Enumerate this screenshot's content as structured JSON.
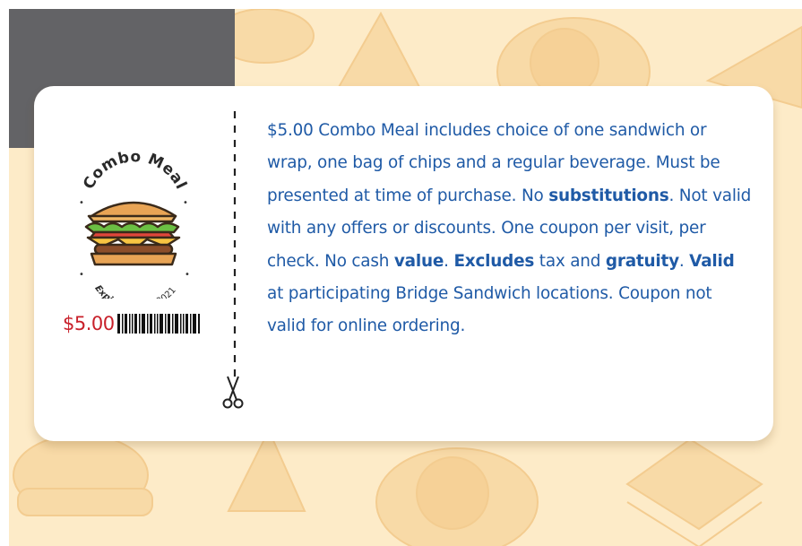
{
  "coupon": {
    "badge_title": "Combo Meal",
    "expires_label": "Expires",
    "expires_date": "01/31/2021",
    "price": "$5.00",
    "terms": [
      {
        "text": "$5.00 Combo Meal includes choice of one sandwich or wrap, one bag of chips and a regular beverage. Must be presented at time of purchase. No ",
        "bold": false
      },
      {
        "text": "substitutions",
        "bold": true
      },
      {
        "text": ". Not valid with any offers or discounts. One coupon per visit, per check. No cash ",
        "bold": false
      },
      {
        "text": "value",
        "bold": true
      },
      {
        "text": ". ",
        "bold": false
      },
      {
        "text": "Excludes",
        "bold": true
      },
      {
        "text": " tax and ",
        "bold": false
      },
      {
        "text": "gratuity",
        "bold": true
      },
      {
        "text": ". ",
        "bold": false
      },
      {
        "text": "Valid",
        "bold": true
      },
      {
        "text": " at participating Bridge Sandwich locations. Coupon not valid for online ordering.",
        "bold": false
      }
    ]
  },
  "colors": {
    "background": "#fdebc8",
    "pattern": "#f8d9a4",
    "dark_block": "#636366",
    "price_red": "#c8202a",
    "terms_blue": "#1f5aa6"
  },
  "icons": {
    "badge": "sandwich-icon",
    "cut": "scissors-icon",
    "background": "food-pattern"
  }
}
